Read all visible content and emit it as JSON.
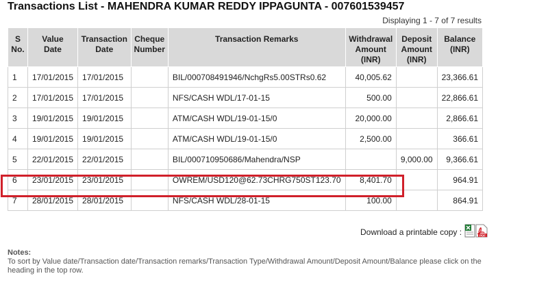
{
  "page": {
    "title": "Transactions List - MAHENDRA KUMAR REDDY IPPAGUNTA - 007601539457",
    "displaying": "Displaying 1 - 7 of 7 results"
  },
  "table": {
    "headers": {
      "sno": [
        "S",
        "No."
      ],
      "value_date": [
        "Value",
        "Date"
      ],
      "transaction_date": [
        "Transaction",
        "Date"
      ],
      "cheque_number": [
        "Cheque",
        "Number"
      ],
      "remarks": [
        "Transaction Remarks"
      ],
      "withdrawal": [
        "Withdrawal",
        "Amount",
        "(INR)"
      ],
      "deposit": [
        "Deposit",
        "Amount",
        "(INR)"
      ],
      "balance": [
        "Balance",
        "(INR)"
      ]
    },
    "rows": [
      {
        "sno": "1",
        "value_date": "17/01/2015",
        "transaction_date": "17/01/2015",
        "cheque": "",
        "remarks": "BIL/000708491946/NchgRs5.00STRs0.62",
        "withdrawal": "40,005.62",
        "deposit": "",
        "balance": "23,366.61"
      },
      {
        "sno": "2",
        "value_date": "17/01/2015",
        "transaction_date": "17/01/2015",
        "cheque": "",
        "remarks": "NFS/CASH WDL/17-01-15",
        "withdrawal": "500.00",
        "deposit": "",
        "balance": "22,866.61"
      },
      {
        "sno": "3",
        "value_date": "19/01/2015",
        "transaction_date": "19/01/2015",
        "cheque": "",
        "remarks": "ATM/CASH WDL/19-01-15/0",
        "withdrawal": "20,000.00",
        "deposit": "",
        "balance": "2,866.61"
      },
      {
        "sno": "4",
        "value_date": "19/01/2015",
        "transaction_date": "19/01/2015",
        "cheque": "",
        "remarks": "ATM/CASH WDL/19-01-15/0",
        "withdrawal": "2,500.00",
        "deposit": "",
        "balance": "366.61"
      },
      {
        "sno": "5",
        "value_date": "22/01/2015",
        "transaction_date": "22/01/2015",
        "cheque": "",
        "remarks": "BIL/000710950686/Mahendra/NSP",
        "withdrawal": "",
        "deposit": "9,000.00",
        "balance": "9,366.61"
      },
      {
        "sno": "6",
        "value_date": "23/01/2015",
        "transaction_date": "23/01/2015",
        "cheque": "",
        "remarks": "OWREM/USD120@62.73CHRG750ST123.70",
        "withdrawal": "8,401.70",
        "deposit": "",
        "balance": "964.91"
      },
      {
        "sno": "7",
        "value_date": "28/01/2015",
        "transaction_date": "28/01/2015",
        "cheque": "",
        "remarks": "NFS/CASH WDL/28-01-15",
        "withdrawal": "100.00",
        "deposit": "",
        "balance": "864.91"
      }
    ]
  },
  "download": {
    "label": "Download a printable copy :",
    "icons": [
      "excel-icon",
      "pdf-icon"
    ],
    "pdf_text": "PDF"
  },
  "notes": {
    "heading": "Notes:",
    "text": "To sort by Value date/Transaction date/Transaction remarks/Transaction Type/Withdrawal Amount/Deposit Amount/Balance please click on the heading in the top row."
  },
  "colors": {
    "header_bg": "#d9d9d9",
    "highlight": "#d0202a"
  }
}
